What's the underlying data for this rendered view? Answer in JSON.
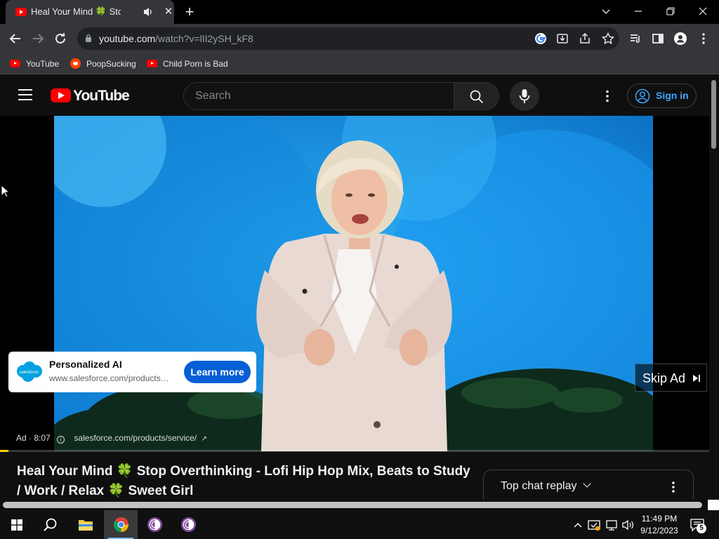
{
  "browser": {
    "tab": {
      "title": "Heal Your Mind 🍀 Stop Overthinking - Lofi Hip Hop Mix, Beats to Study / Work / Relax 🍀 Sweet Girl",
      "favicon": "youtube-icon",
      "audio_icon": "speaker-icon"
    },
    "new_tab_label": "+",
    "window_controls": [
      "chevron-down-icon",
      "minimize-icon",
      "restore-icon",
      "close-icon"
    ],
    "address": {
      "host": "youtube.com",
      "path": "/watch?v=lII2ySH_kF8"
    },
    "bookmarks": [
      {
        "label": "YouTube",
        "icon": "youtube-icon"
      },
      {
        "label": "PoopSucking",
        "icon": "reddit-icon"
      },
      {
        "label": "Child Porn is Bad",
        "icon": "youtube-icon"
      }
    ]
  },
  "youtube": {
    "logo_text": "YouTube",
    "search": {
      "placeholder": "Search"
    },
    "sign_in_label": "Sign in"
  },
  "ad": {
    "card_title": "Personalized AI",
    "card_url": "www.salesforce.com/products/service/",
    "learn_more_label": "Learn more",
    "skip_label": "Skip Ad",
    "ad_label": "Ad · 8:07",
    "ad_url": "salesforce.com/products/service/",
    "progress_fraction": 0.012,
    "advertiser_logo_text": "salesforce"
  },
  "video": {
    "title": "Heal Your Mind 🍀 Stop Overthinking - Lofi Hip Hop Mix, Beats to Study / Work / Relax 🍀 Sweet Girl"
  },
  "chat": {
    "label": "Top chat replay"
  },
  "taskbar": {
    "time": "11:49 PM",
    "date": "9/12/2023",
    "notification_count": "5"
  },
  "colors": {
    "youtube_red": "#ff0000",
    "link_blue": "#3ea6ff",
    "learn_more_blue": "#065fd4",
    "ad_progress": "#ffcc00",
    "video_bg": "#1e9bf0"
  }
}
